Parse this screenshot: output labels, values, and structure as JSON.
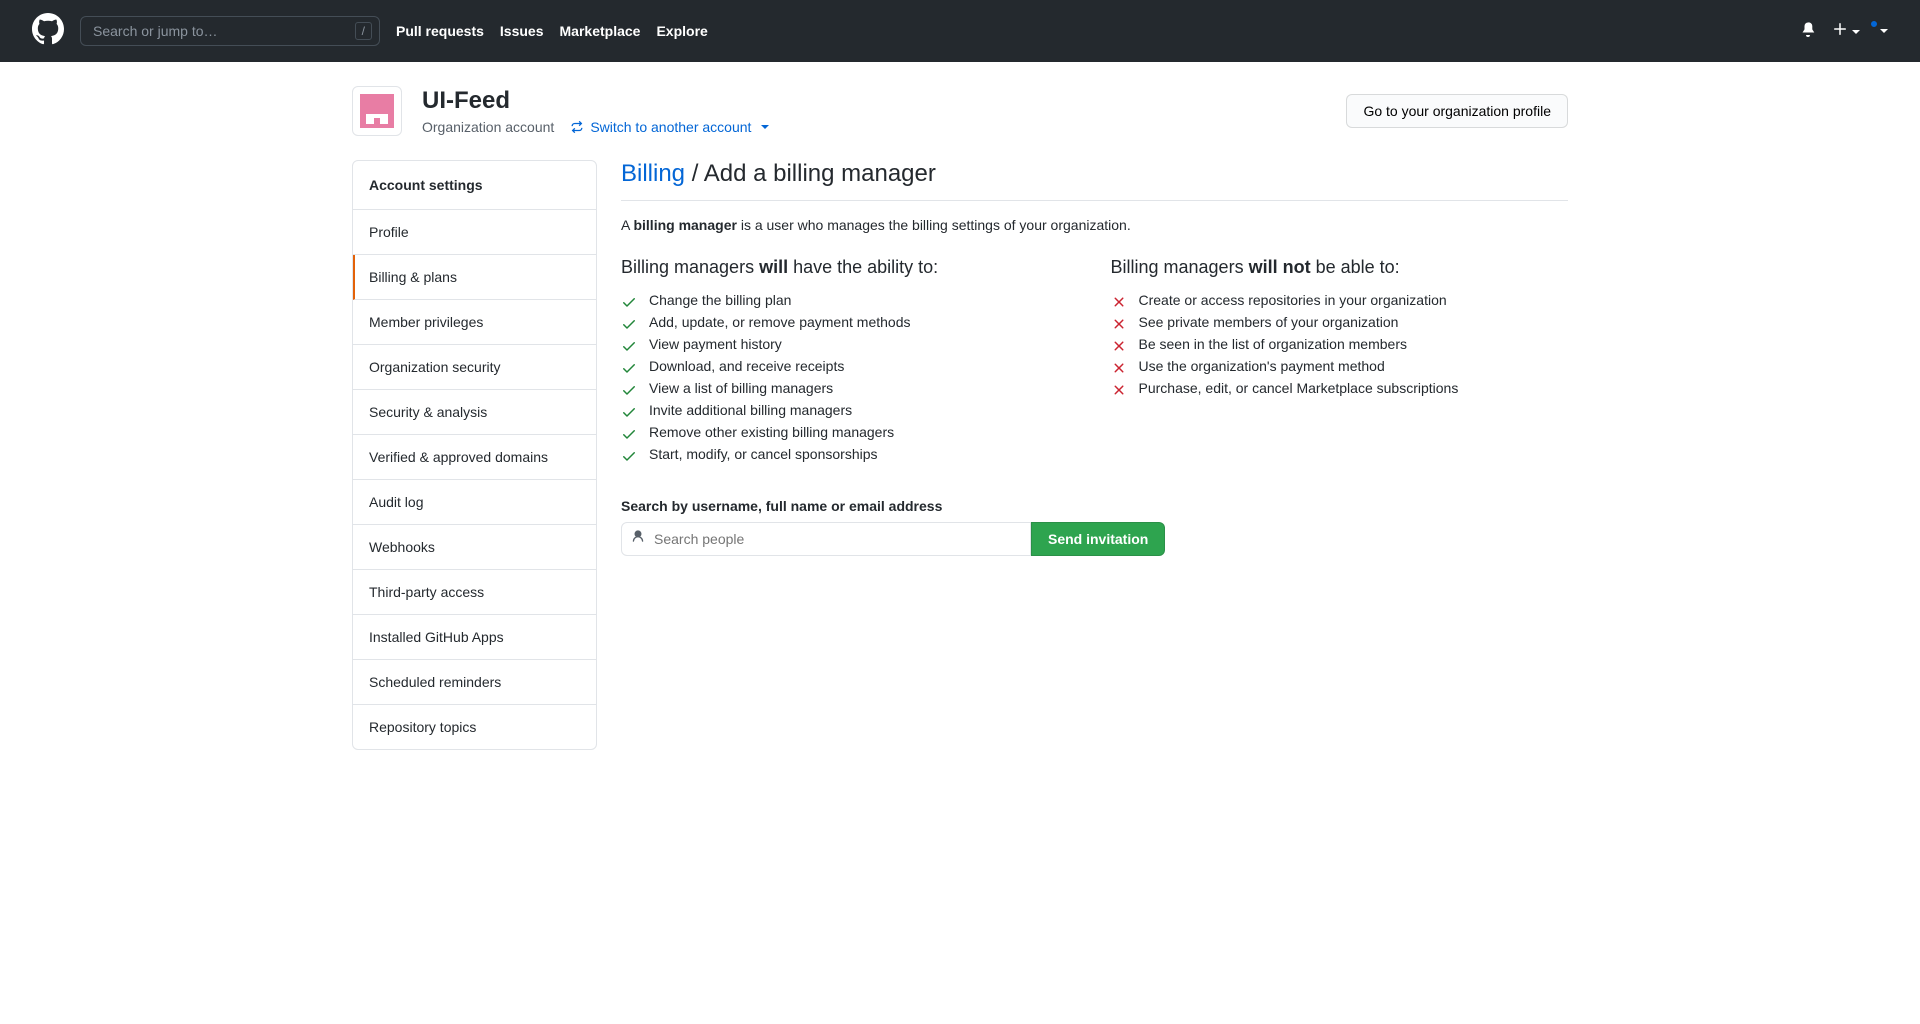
{
  "header": {
    "search_placeholder": "Search or jump to…",
    "slash": "/",
    "nav": [
      {
        "label": "Pull requests"
      },
      {
        "label": "Issues"
      },
      {
        "label": "Marketplace"
      },
      {
        "label": "Explore"
      }
    ]
  },
  "org": {
    "name": "UI-Feed",
    "type": "Organization account",
    "switch_label": "Switch to another account",
    "profile_button": "Go to your organization profile"
  },
  "sidebar": {
    "header": "Account settings",
    "items": [
      {
        "label": "Profile"
      },
      {
        "label": "Billing & plans"
      },
      {
        "label": "Member privileges"
      },
      {
        "label": "Organization security"
      },
      {
        "label": "Security & analysis"
      },
      {
        "label": "Verified & approved domains"
      },
      {
        "label": "Audit log"
      },
      {
        "label": "Webhooks"
      },
      {
        "label": "Third-party access"
      },
      {
        "label": "Installed GitHub Apps"
      },
      {
        "label": "Scheduled reminders"
      },
      {
        "label": "Repository topics"
      }
    ]
  },
  "page": {
    "title_link": "Billing",
    "title_sep": " / ",
    "title_rest": "Add a billing manager",
    "desc_pre": "A ",
    "desc_bold": "billing manager",
    "desc_post": " is a user who manages the billing settings of your organization.",
    "will_title_pre": "Billing managers ",
    "will_title_bold": "will",
    "will_title_post": " have the ability to:",
    "wont_title_pre": "Billing managers ",
    "wont_title_bold": "will not",
    "wont_title_post": " be able to:",
    "will_list": [
      "Change the billing plan",
      "Add, update, or remove payment methods",
      "View payment history",
      "Download, and receive receipts",
      "View a list of billing managers",
      "Invite additional billing managers",
      "Remove other existing billing managers",
      "Start, modify, or cancel sponsorships"
    ],
    "wont_list": [
      "Create or access repositories in your organization",
      "See private members of your organization",
      "Be seen in the list of organization members",
      "Use the organization's payment method",
      "Purchase, edit, or cancel Marketplace subscriptions"
    ],
    "search_label": "Search by username, full name or email address",
    "people_placeholder": "Search people",
    "send_button": "Send invitation"
  }
}
